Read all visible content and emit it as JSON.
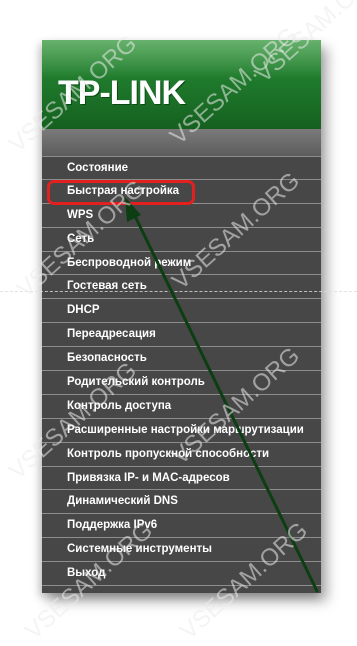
{
  "logo": "TP-LINK",
  "menu": [
    "Состояние",
    "Быстрая настройка",
    "WPS",
    "Сеть",
    "Беспроводной режим",
    "Гостевая сеть",
    "DHCP",
    "Переадресация",
    "Безопасность",
    "Родительский контроль",
    "Контроль доступа",
    "Расширенные настройки маршрутизации",
    "Контроль пропускной способности",
    "Привязка IP- и MAC-адресов",
    "Динамический DNS",
    "Поддержка IPv6",
    "Системные инструменты",
    "Выход"
  ],
  "watermark": "VSESAM.ORG",
  "colors": {
    "brand_green": "#1f7a2c",
    "menu_background": "#474747",
    "highlight": "#e12020",
    "arrow": "#0d3d12"
  }
}
